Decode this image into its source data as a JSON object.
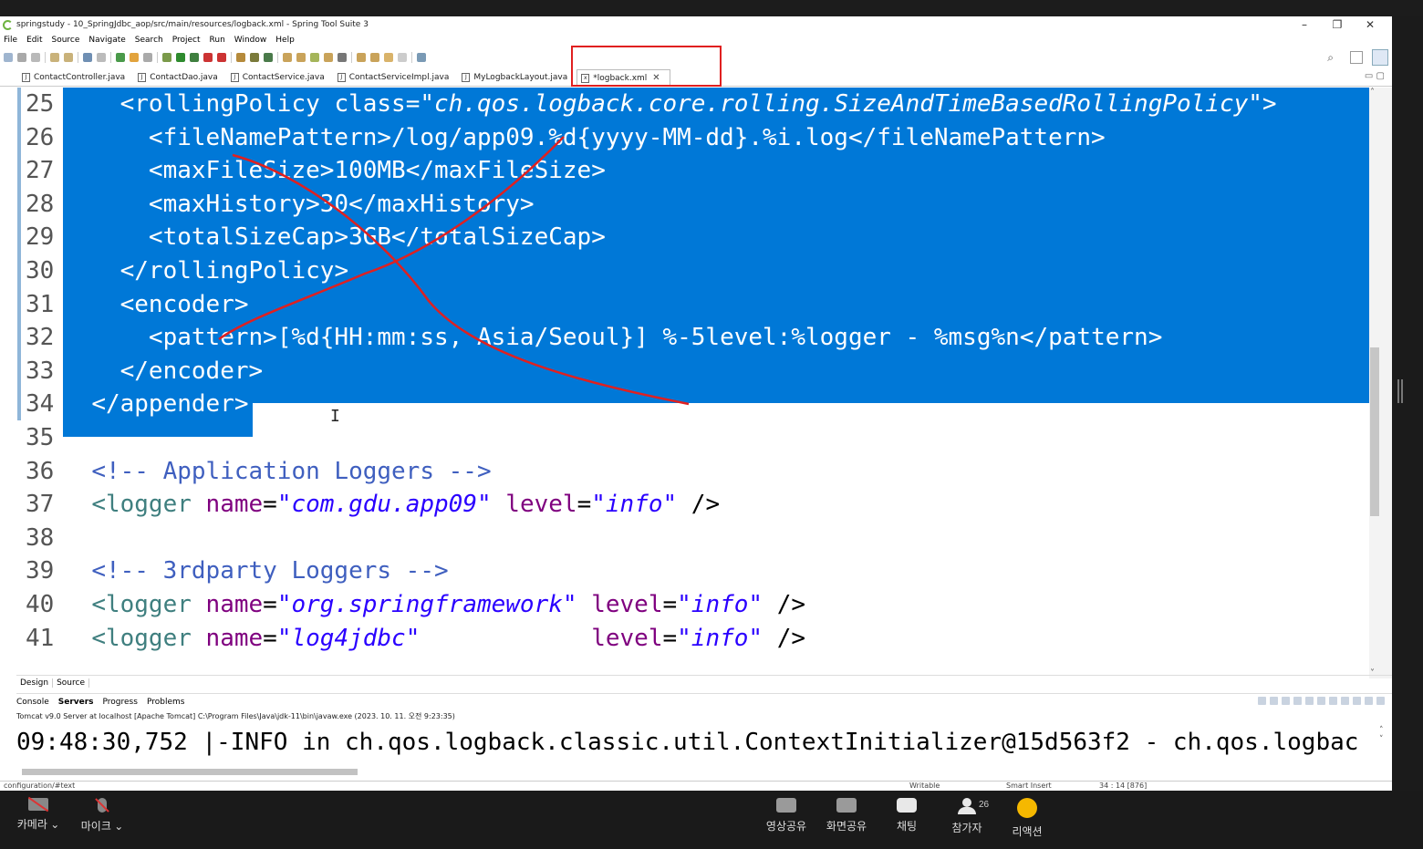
{
  "window": {
    "title": "springstudy - 10_SpringJdbc_aop/src/main/resources/logback.xml - Spring Tool Suite 3",
    "controls": [
      "–",
      "❐",
      "✕"
    ]
  },
  "menu": [
    "File",
    "Edit",
    "Source",
    "Navigate",
    "Search",
    "Project",
    "Run",
    "Window",
    "Help"
  ],
  "tabs": [
    {
      "label": "ContactController.java",
      "active": false
    },
    {
      "label": "ContactDao.java",
      "active": false
    },
    {
      "label": "ContactService.java",
      "active": false
    },
    {
      "label": "ContactServiceImpl.java",
      "active": false
    },
    {
      "label": "MyLogbackLayout.java",
      "active": false
    },
    {
      "label": "*logback.xml",
      "active": true
    }
  ],
  "tab_close": "✕",
  "editor": {
    "line_numbers": [
      "25",
      "26",
      "27",
      "28",
      "29",
      "30",
      "31",
      "32",
      "33",
      "34",
      "35",
      "36",
      "37",
      "38",
      "39",
      "40",
      "41"
    ],
    "lines": [
      "    <rollingPolicy class=\"ch.qos.logback.core.rolling.SizeAndTimeBasedRollingPolicy\">",
      "      <fileNamePattern>/log/app09.%d{yyyy-MM-dd}.%i.log</fileNamePattern>",
      "      <maxFileSize>100MB</maxFileSize>",
      "      <maxHistory>30</maxHistory>",
      "      <totalSizeCap>3GB</totalSizeCap>",
      "    </rollingPolicy>",
      "    <encoder>",
      "      <pattern>[%d{HH:mm:ss, Asia/Seoul}] %-5level:%logger - %msg%n</pattern>",
      "    </encoder>",
      "  </appender>",
      "",
      "  <!-- Application Loggers -->",
      "  <logger name=\"com.gdu.app09\" level=\"info\" />",
      "",
      "  <!-- 3rdparty Loggers -->",
      "  <logger name=\"org.springframework\" level=\"info\" />",
      "  <logger name=\"log4jdbc\"            level=\"info\" />"
    ]
  },
  "editor_bottom_tabs": [
    "Design",
    "Source"
  ],
  "views": {
    "tabs": [
      "Console",
      "Servers",
      "Progress",
      "Problems"
    ],
    "console_description": "Tomcat v9.0 Server at localhost [Apache Tomcat] C:\\Program Files\\Java\\jdk-11\\bin\\javaw.exe  (2023. 10. 11. 오전 9:23:35)",
    "console_output": "09:48:30,752 |-INFO in ch.qos.logback.classic.util.ContextInitializer@15d563f2 - ch.qos.logbac"
  },
  "status": {
    "path": "configuration/#text",
    "writable": "Writable",
    "insert_mode": "Smart Insert",
    "position": "34 : 14 [876]"
  },
  "meeting": {
    "camera": "카메라 ⌄",
    "mic": "마이크 ⌄",
    "share_video": "영상공유",
    "share_screen": "화면공유",
    "chat": "채팅",
    "participants": "참가자",
    "participant_count": "26",
    "reaction": "리액션"
  },
  "annotation_color": "#e02020",
  "selection_color": "#0078d7"
}
